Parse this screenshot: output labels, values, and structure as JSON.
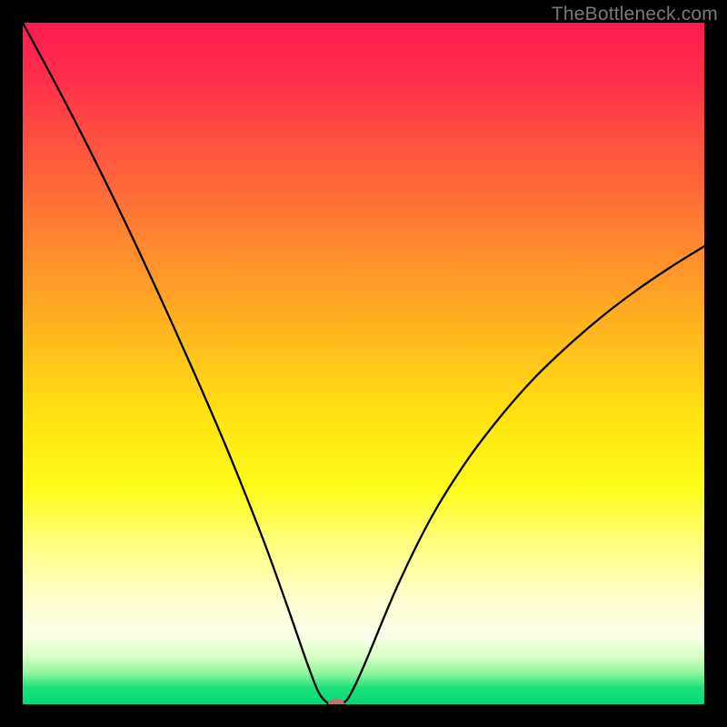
{
  "watermark": "TheBottleneck.com",
  "chart_data": {
    "type": "line",
    "title": "",
    "xlabel": "",
    "ylabel": "",
    "xlim": [
      0,
      100
    ],
    "ylim": [
      0,
      100
    ],
    "background_gradient": {
      "direction": "vertical",
      "stops": [
        {
          "pos": 0,
          "color": "#ff1a52"
        },
        {
          "pos": 20,
          "color": "#ff5a3e"
        },
        {
          "pos": 46,
          "color": "#ffb91e"
        },
        {
          "pos": 68,
          "color": "#fffb18"
        },
        {
          "pos": 90,
          "color": "#fbffe8"
        },
        {
          "pos": 100,
          "color": "#00d977"
        }
      ]
    },
    "series": [
      {
        "name": "bottleneck-curve",
        "x": [
          0,
          5,
          10,
          15,
          20,
          25,
          30,
          35,
          38,
          40,
          42,
          43.5,
          45,
          46,
          47,
          48,
          50,
          55,
          60,
          65,
          70,
          75,
          80,
          85,
          90,
          95,
          100
        ],
        "y": [
          100,
          90.7,
          81,
          70.8,
          60.1,
          49,
          37.4,
          24.9,
          16.7,
          11,
          5.3,
          1.6,
          0,
          0,
          0.2,
          1.3,
          5.5,
          17.4,
          27.5,
          35.5,
          42.1,
          47.8,
          52.6,
          56.9,
          60.7,
          64.1,
          67.2
        ]
      }
    ],
    "markers": [
      {
        "name": "optimal-point",
        "x": 46,
        "y": 0,
        "color": "#c4746f"
      }
    ],
    "grid": false,
    "legend": false
  }
}
